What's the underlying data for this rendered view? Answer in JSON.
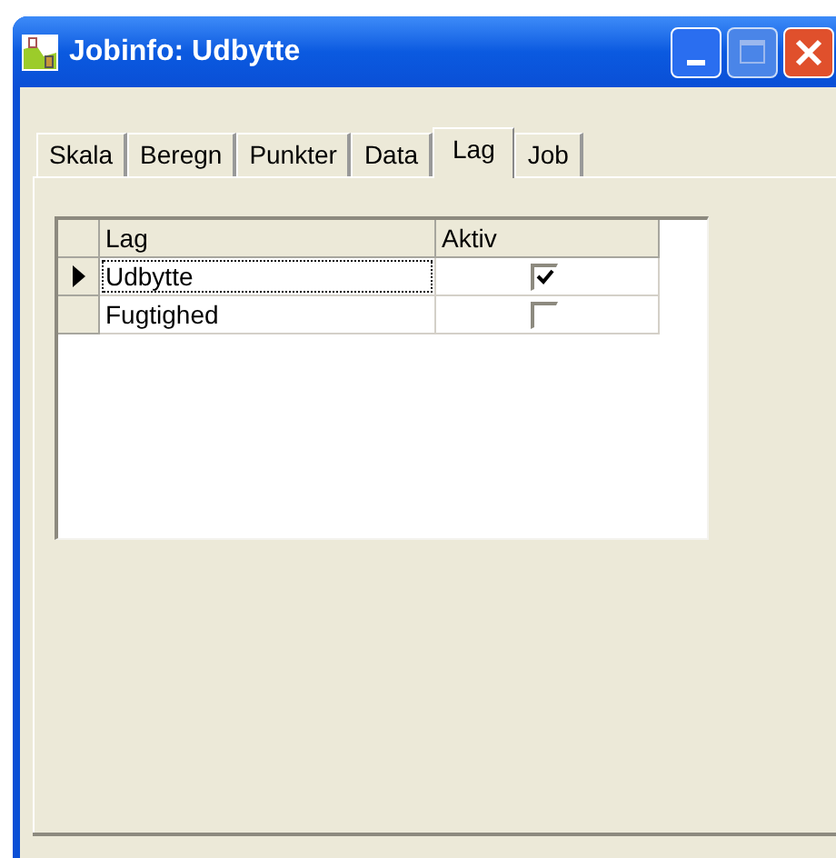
{
  "window": {
    "title": "Jobinfo: Udbytte"
  },
  "tabs": [
    {
      "label": "Skala",
      "selected": false
    },
    {
      "label": "Beregn",
      "selected": false
    },
    {
      "label": "Punkter",
      "selected": false
    },
    {
      "label": "Data",
      "selected": false
    },
    {
      "label": "Lag",
      "selected": true
    },
    {
      "label": "Job",
      "selected": false
    }
  ],
  "table": {
    "columns": [
      "Lag",
      "Aktiv"
    ],
    "rows": [
      {
        "name": "Udbytte",
        "checked": true,
        "selected": true
      },
      {
        "name": "Fugtighed",
        "checked": false,
        "selected": false
      }
    ]
  }
}
